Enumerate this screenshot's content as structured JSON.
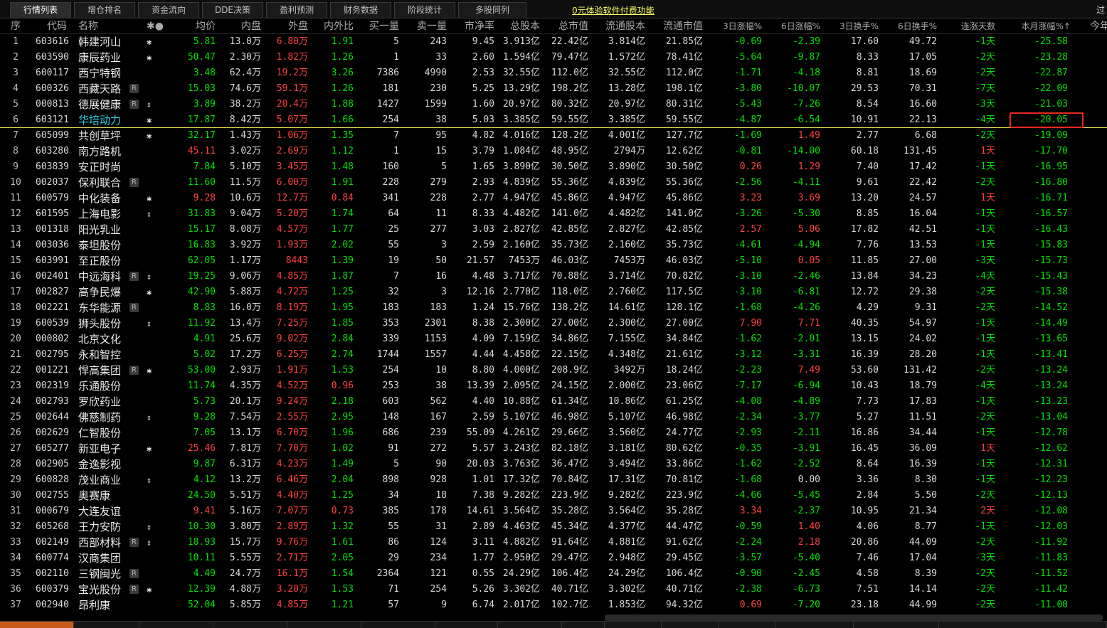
{
  "tabs": [
    "行情列表",
    "增仓排名",
    "资金流向",
    "DDE决策",
    "盈利预测",
    "财务数据",
    "阶段统计",
    "多股同列"
  ],
  "promo": "0元体验软件付费功能",
  "window_ctrl": "过",
  "headers": [
    "序",
    "代码",
    "名称",
    "✱●",
    "均价",
    "内盘",
    "外盘",
    "内外比",
    "买一量",
    "卖一量",
    "市净率",
    "总股本",
    "总市值",
    "流通股本",
    "流通市值",
    "3日涨幅%",
    "6日涨幅%",
    "3日换手%",
    "6日换手%",
    "连涨天数",
    "本月涨幅%↑",
    "今年"
  ],
  "rows": [
    [
      "1",
      "603616",
      "韩建河山",
      "",
      "✱",
      "5.81",
      "13.0万",
      "6.80万",
      "1.91",
      "5",
      "243",
      "9.45",
      "3.913亿",
      "22.42亿",
      "3.814亿",
      "21.85亿",
      "-0.69",
      "-2.39",
      "17.60",
      "49.72",
      "-1天",
      "-25.58"
    ],
    [
      "2",
      "603590",
      "康辰药业",
      "",
      "✱",
      "50.47",
      "2.30万",
      "1.82万",
      "1.26",
      "1",
      "33",
      "2.60",
      "1.594亿",
      "79.47亿",
      "1.572亿",
      "78.41亿",
      "-5.64",
      "-9.87",
      "8.33",
      "17.05",
      "-2天",
      "-23.28"
    ],
    [
      "3",
      "600117",
      "西宁特钢",
      "",
      "",
      "3.48",
      "62.4万",
      "19.2万",
      "3.26",
      "7386",
      "4990",
      "2.53",
      "32.55亿",
      "112.0亿",
      "32.55亿",
      "112.0亿",
      "-1.71",
      "-4.18",
      "8.81",
      "18.69",
      "-2天",
      "-22.87"
    ],
    [
      "4",
      "600326",
      "西藏天路",
      "R",
      "",
      "15.03",
      "74.6万",
      "59.1万",
      "1.26",
      "181",
      "230",
      "5.25",
      "13.29亿",
      "198.2亿",
      "13.28亿",
      "198.1亿",
      "-3.80",
      "-10.07",
      "29.53",
      "70.31",
      "-7天",
      "-22.09"
    ],
    [
      "5",
      "000813",
      "德展健康",
      "R",
      "⇕",
      "3.89",
      "38.2万",
      "20.4万",
      "1.88",
      "1427",
      "1599",
      "1.60",
      "20.97亿",
      "80.32亿",
      "20.97亿",
      "80.31亿",
      "-5.43",
      "-7.26",
      "8.54",
      "16.60",
      "-3天",
      "-21.03"
    ],
    [
      "6",
      "603121",
      "华培动力",
      "",
      "✱",
      "17.87",
      "8.42万",
      "5.07万",
      "1.66",
      "254",
      "38",
      "5.03",
      "3.385亿",
      "59.55亿",
      "3.385亿",
      "59.55亿",
      "-4.87",
      "-6.54",
      "10.91",
      "22.13",
      "-4天",
      "-20.05"
    ],
    [
      "7",
      "605099",
      "共创草坪",
      "",
      "✱",
      "32.17",
      "1.43万",
      "1.06万",
      "1.35",
      "7",
      "95",
      "4.82",
      "4.016亿",
      "128.2亿",
      "4.001亿",
      "127.7亿",
      "-1.69",
      "1.49",
      "2.77",
      "6.68",
      "-2天",
      "-19.09"
    ],
    [
      "8",
      "603280",
      "南方路机",
      "",
      "",
      "45.11",
      "3.02万",
      "2.69万",
      "1.12",
      "1",
      "15",
      "3.79",
      "1.084亿",
      "48.95亿",
      "2794万",
      "12.62亿",
      "-0.81",
      "-14.00",
      "60.18",
      "131.45",
      "1天",
      "-17.70"
    ],
    [
      "9",
      "603839",
      "安正时尚",
      "",
      "",
      "7.84",
      "5.10万",
      "3.45万",
      "1.48",
      "160",
      "5",
      "1.65",
      "3.890亿",
      "30.50亿",
      "3.890亿",
      "30.50亿",
      "0.26",
      "1.29",
      "7.40",
      "17.42",
      "-1天",
      "-16.95"
    ],
    [
      "10",
      "002037",
      "保利联合",
      "R",
      "",
      "11.60",
      "11.5万",
      "6.00万",
      "1.91",
      "228",
      "279",
      "2.93",
      "4.839亿",
      "55.36亿",
      "4.839亿",
      "55.36亿",
      "-2.56",
      "-4.11",
      "9.61",
      "22.42",
      "-2天",
      "-16.80"
    ],
    [
      "11",
      "600579",
      "中化装备",
      "",
      "✱",
      "9.28",
      "10.6万",
      "12.7万",
      "0.84",
      "341",
      "228",
      "2.77",
      "4.947亿",
      "45.86亿",
      "4.947亿",
      "45.86亿",
      "3.23",
      "3.69",
      "13.20",
      "24.57",
      "1天",
      "-16.71"
    ],
    [
      "12",
      "601595",
      "上海电影",
      "",
      "⇕",
      "31.83",
      "9.04万",
      "5.20万",
      "1.74",
      "64",
      "11",
      "8.33",
      "4.482亿",
      "141.0亿",
      "4.482亿",
      "141.0亿",
      "-3.26",
      "-5.30",
      "8.85",
      "16.04",
      "-1天",
      "-16.57"
    ],
    [
      "13",
      "001318",
      "阳光乳业",
      "",
      "",
      "15.17",
      "8.08万",
      "4.57万",
      "1.77",
      "25",
      "277",
      "3.03",
      "2.827亿",
      "42.85亿",
      "2.827亿",
      "42.85亿",
      "2.57",
      "5.06",
      "17.82",
      "42.51",
      "-1天",
      "-16.43"
    ],
    [
      "14",
      "003036",
      "泰坦股份",
      "",
      "",
      "16.83",
      "3.92万",
      "1.93万",
      "2.02",
      "55",
      "3",
      "2.59",
      "2.160亿",
      "35.73亿",
      "2.160亿",
      "35.73亿",
      "-4.61",
      "-4.94",
      "7.76",
      "13.53",
      "-1天",
      "-15.83"
    ],
    [
      "15",
      "603991",
      "至正股份",
      "",
      "",
      "62.05",
      "1.17万",
      "8443",
      "1.39",
      "19",
      "50",
      "21.57",
      "7453万",
      "46.03亿",
      "7453万",
      "46.03亿",
      "-5.10",
      "0.05",
      "11.85",
      "27.00",
      "-3天",
      "-15.73"
    ],
    [
      "16",
      "002401",
      "中远海科",
      "R",
      "⇕",
      "19.25",
      "9.06万",
      "4.85万",
      "1.87",
      "7",
      "16",
      "4.48",
      "3.717亿",
      "70.88亿",
      "3.714亿",
      "70.82亿",
      "-3.10",
      "-2.46",
      "13.84",
      "34.23",
      "-4天",
      "-15.43"
    ],
    [
      "17",
      "002827",
      "高争民爆",
      "",
      "✱",
      "42.90",
      "5.88万",
      "4.72万",
      "1.25",
      "32",
      "3",
      "12.16",
      "2.770亿",
      "118.0亿",
      "2.760亿",
      "117.5亿",
      "-3.10",
      "-6.81",
      "12.72",
      "29.38",
      "-2天",
      "-15.38"
    ],
    [
      "18",
      "002221",
      "东华能源",
      "R",
      "",
      "8.83",
      "16.0万",
      "8.19万",
      "1.95",
      "183",
      "183",
      "1.24",
      "15.76亿",
      "138.2亿",
      "14.61亿",
      "128.1亿",
      "-1.68",
      "-4.26",
      "4.29",
      "9.31",
      "-2天",
      "-14.52"
    ],
    [
      "19",
      "600539",
      "狮头股份",
      "",
      "⇕",
      "11.92",
      "13.4万",
      "7.25万",
      "1.85",
      "353",
      "2301",
      "8.38",
      "2.300亿",
      "27.00亿",
      "2.300亿",
      "27.00亿",
      "7.90",
      "7.71",
      "40.35",
      "54.97",
      "-1天",
      "-14.49"
    ],
    [
      "20",
      "000802",
      "北京文化",
      "",
      "",
      "4.91",
      "25.6万",
      "9.02万",
      "2.84",
      "339",
      "1153",
      "4.09",
      "7.159亿",
      "34.86亿",
      "7.155亿",
      "34.84亿",
      "-1.62",
      "-2.01",
      "13.15",
      "24.02",
      "-1天",
      "-13.65"
    ],
    [
      "21",
      "002795",
      "永和智控",
      "",
      "",
      "5.02",
      "17.2万",
      "6.25万",
      "2.74",
      "1744",
      "1557",
      "4.44",
      "4.458亿",
      "22.15亿",
      "4.348亿",
      "21.61亿",
      "-3.12",
      "-3.31",
      "16.39",
      "28.20",
      "-1天",
      "-13.41"
    ],
    [
      "22",
      "001221",
      "悍高集团",
      "R",
      "✱",
      "53.00",
      "2.93万",
      "1.91万",
      "1.53",
      "254",
      "10",
      "8.80",
      "4.000亿",
      "208.9亿",
      "3492万",
      "18.24亿",
      "-2.23",
      "7.49",
      "53.60",
      "131.42",
      "-2天",
      "-13.24"
    ],
    [
      "23",
      "002319",
      "乐通股份",
      "",
      "",
      "11.74",
      "4.35万",
      "4.52万",
      "0.96",
      "253",
      "38",
      "13.39",
      "2.095亿",
      "24.15亿",
      "2.000亿",
      "23.06亿",
      "-7.17",
      "-6.94",
      "10.43",
      "18.79",
      "-4天",
      "-13.24"
    ],
    [
      "24",
      "002793",
      "罗欣药业",
      "",
      "",
      "5.73",
      "20.1万",
      "9.24万",
      "2.18",
      "603",
      "562",
      "4.40",
      "10.88亿",
      "61.34亿",
      "10.86亿",
      "61.25亿",
      "-4.08",
      "-4.89",
      "7.73",
      "17.83",
      "-1天",
      "-13.23"
    ],
    [
      "25",
      "002644",
      "佛慈制药",
      "",
      "⇕",
      "9.28",
      "7.54万",
      "2.55万",
      "2.95",
      "148",
      "167",
      "2.59",
      "5.107亿",
      "46.98亿",
      "5.107亿",
      "46.98亿",
      "-2.34",
      "-3.77",
      "5.27",
      "11.51",
      "-2天",
      "-13.04"
    ],
    [
      "26",
      "002629",
      "仁智股份",
      "",
      "",
      "7.05",
      "13.1万",
      "6.70万",
      "1.96",
      "686",
      "239",
      "55.09",
      "4.261亿",
      "29.66亿",
      "3.560亿",
      "24.77亿",
      "-2.93",
      "-2.11",
      "16.86",
      "34.44",
      "-1天",
      "-12.78"
    ],
    [
      "27",
      "605277",
      "新亚电子",
      "",
      "✱",
      "25.46",
      "7.81万",
      "7.70万",
      "1.02",
      "91",
      "272",
      "5.57",
      "3.243亿",
      "82.18亿",
      "3.181亿",
      "80.62亿",
      "-0.35",
      "-3.91",
      "16.45",
      "36.09",
      "1天",
      "-12.62"
    ],
    [
      "28",
      "002905",
      "金逸影视",
      "",
      "",
      "9.87",
      "6.31万",
      "4.23万",
      "1.49",
      "5",
      "90",
      "20.03",
      "3.763亿",
      "36.47亿",
      "3.494亿",
      "33.86亿",
      "-1.62",
      "-2.52",
      "8.64",
      "16.39",
      "-1天",
      "-12.31"
    ],
    [
      "29",
      "600828",
      "茂业商业",
      "",
      "⇕",
      "4.12",
      "13.2万",
      "6.46万",
      "2.04",
      "898",
      "928",
      "1.01",
      "17.32亿",
      "70.84亿",
      "17.31亿",
      "70.81亿",
      "-1.68",
      "0.00",
      "3.36",
      "8.30",
      "-1天",
      "-12.23"
    ],
    [
      "30",
      "002755",
      "奥赛康",
      "",
      "",
      "24.50",
      "5.51万",
      "4.40万",
      "1.25",
      "34",
      "18",
      "7.38",
      "9.282亿",
      "223.9亿",
      "9.282亿",
      "223.9亿",
      "-4.66",
      "-5.45",
      "2.84",
      "5.50",
      "-2天",
      "-12.13"
    ],
    [
      "31",
      "000679",
      "大连友谊",
      "",
      "",
      "9.41",
      "5.16万",
      "7.07万",
      "0.73",
      "385",
      "178",
      "14.61",
      "3.564亿",
      "35.28亿",
      "3.564亿",
      "35.28亿",
      "3.34",
      "-2.37",
      "10.95",
      "21.34",
      "2天",
      "-12.08"
    ],
    [
      "32",
      "605268",
      "王力安防",
      "",
      "⇕",
      "10.30",
      "3.80万",
      "2.89万",
      "1.32",
      "55",
      "31",
      "2.89",
      "4.463亿",
      "45.34亿",
      "4.377亿",
      "44.47亿",
      "-0.59",
      "1.40",
      "4.06",
      "8.77",
      "-1天",
      "-12.03"
    ],
    [
      "33",
      "002149",
      "西部材料",
      "R",
      "⇕",
      "18.93",
      "15.7万",
      "9.76万",
      "1.61",
      "86",
      "124",
      "3.11",
      "4.882亿",
      "91.64亿",
      "4.881亿",
      "91.62亿",
      "-2.24",
      "2.18",
      "20.86",
      "44.09",
      "-2天",
      "-11.92"
    ],
    [
      "34",
      "600774",
      "汉商集团",
      "",
      "",
      "10.11",
      "5.55万",
      "2.71万",
      "2.05",
      "29",
      "234",
      "1.77",
      "2.950亿",
      "29.47亿",
      "2.948亿",
      "29.45亿",
      "-3.57",
      "-5.40",
      "7.46",
      "17.04",
      "-3天",
      "-11.83"
    ],
    [
      "35",
      "002110",
      "三钢闽光",
      "R",
      "",
      "4.49",
      "24.7万",
      "16.1万",
      "1.54",
      "2364",
      "121",
      "0.55",
      "24.29亿",
      "106.4亿",
      "24.29亿",
      "106.4亿",
      "-0.90",
      "-2.45",
      "4.58",
      "8.39",
      "-2天",
      "-11.52"
    ],
    [
      "36",
      "600379",
      "宝光股份",
      "R",
      "✱",
      "12.39",
      "4.88万",
      "3.20万",
      "1.53",
      "71",
      "254",
      "5.26",
      "3.302亿",
      "40.71亿",
      "3.302亿",
      "40.71亿",
      "-2.38",
      "-6.73",
      "7.51",
      "14.14",
      "-2天",
      "-11.42"
    ],
    [
      "37",
      "002940",
      "昂利康",
      "",
      "",
      "52.04",
      "5.85万",
      "4.85万",
      "1.21",
      "57",
      "9",
      "6.74",
      "2.017亿",
      "102.7亿",
      "1.853亿",
      "94.32亿",
      "0.69",
      "-7.20",
      "23.18",
      "44.99",
      "-2天",
      "-11.00"
    ]
  ],
  "avg_price_colors": [
    "g",
    "g",
    "g",
    "g",
    "g",
    "g",
    "g",
    "r",
    "g",
    "g",
    "r",
    "g",
    "g",
    "g",
    "g",
    "g",
    "g",
    "g",
    "g",
    "g",
    "g",
    "g",
    "g",
    "g",
    "g",
    "g",
    "r",
    "g",
    "g",
    "g",
    "r",
    "g",
    "g",
    "g",
    "g",
    "g",
    "g"
  ],
  "in_out_ratio_colors": [
    "g",
    "g",
    "g",
    "g",
    "g",
    "g",
    "g",
    "g",
    "g",
    "g",
    "r",
    "g",
    "g",
    "g",
    "g",
    "g",
    "g",
    "g",
    "g",
    "g",
    "g",
    "g",
    "r",
    "g",
    "g",
    "g",
    "g",
    "g",
    "g",
    "g",
    "r",
    "g",
    "g",
    "g",
    "g",
    "g",
    "g"
  ],
  "bottom_tabs": [
    "",
    "",
    "",
    "",
    "",
    "",
    "",
    "",
    "",
    "",
    "",
    "",
    "",
    "",
    ""
  ],
  "colors": {
    "up": "#ff4040",
    "down": "#00e000",
    "highlight_box": "#e8281e",
    "selected_line": "#e8e05a",
    "selected_name": "#28d7e8"
  }
}
